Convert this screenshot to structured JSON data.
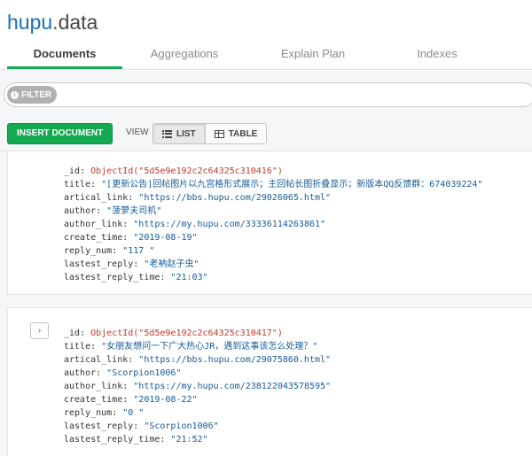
{
  "header": {
    "db_name": "hupu",
    "collection_name": "data",
    "tabs": [
      {
        "label": "Documents",
        "active": true
      },
      {
        "label": "Aggregations",
        "active": false
      },
      {
        "label": "Explain Plan",
        "active": false
      },
      {
        "label": "Indexes",
        "active": false
      }
    ]
  },
  "filter": {
    "pill_label": "FILTER",
    "value": ""
  },
  "toolbar": {
    "insert_label": "INSERT DOCUMENT",
    "view_label": "VIEW",
    "list_label": "LIST",
    "table_label": "TABLE",
    "active_view": "LIST"
  },
  "documents": [
    {
      "id_key": "_id",
      "id_value": "ObjectId(\"5d5e9e192c2c64325c310416\")",
      "fields": [
        {
          "key": "title",
          "value": "\"[更新公告]回帖图片以九宫格形式展示；主回帖长图折叠显示；新版本QQ反馈群：674039224\""
        },
        {
          "key": "artical_link",
          "value": "\"https://bbs.hupu.com/29026065.html\""
        },
        {
          "key": "author",
          "value": "\"菠萝夫司机\""
        },
        {
          "key": "author_link",
          "value": "\"https://my.hupu.com/33336114263861\""
        },
        {
          "key": "create_time",
          "value": "\"2019-08-19\""
        },
        {
          "key": "reply_num",
          "value": "\"117 \""
        },
        {
          "key": "lastest_reply",
          "value": "\"老衲赵子虫\""
        },
        {
          "key": "lastest_reply_time",
          "value": "\"21:03\""
        }
      ]
    },
    {
      "id_key": "_id",
      "id_value": "ObjectId(\"5d5e9e192c2c64325c310417\")",
      "fields": [
        {
          "key": "title",
          "value": "\"女朋友想问一下广大热心JR，遇到这事该怎么处理？\""
        },
        {
          "key": "artical_link",
          "value": "\"https://bbs.hupu.com/29075860.html\""
        },
        {
          "key": "author",
          "value": "\"Scorpion1006\""
        },
        {
          "key": "author_link",
          "value": "\"https://my.hupu.com/238122043578595\""
        },
        {
          "key": "create_time",
          "value": "\"2019-08-22\""
        },
        {
          "key": "reply_num",
          "value": "\"0 \""
        },
        {
          "key": "lastest_reply",
          "value": "\"Scorpion1006\""
        },
        {
          "key": "lastest_reply_time",
          "value": "\"21:52\""
        }
      ]
    }
  ],
  "icons": {
    "info": "info-icon",
    "list": "list-icon",
    "table": "table-icon",
    "expand": "chevron-right-icon"
  },
  "colors": {
    "accent_green": "#13aa52",
    "db_blue": "#1a6fb5",
    "value_blue": "#145a9a",
    "objectid_red": "#c0392b"
  }
}
